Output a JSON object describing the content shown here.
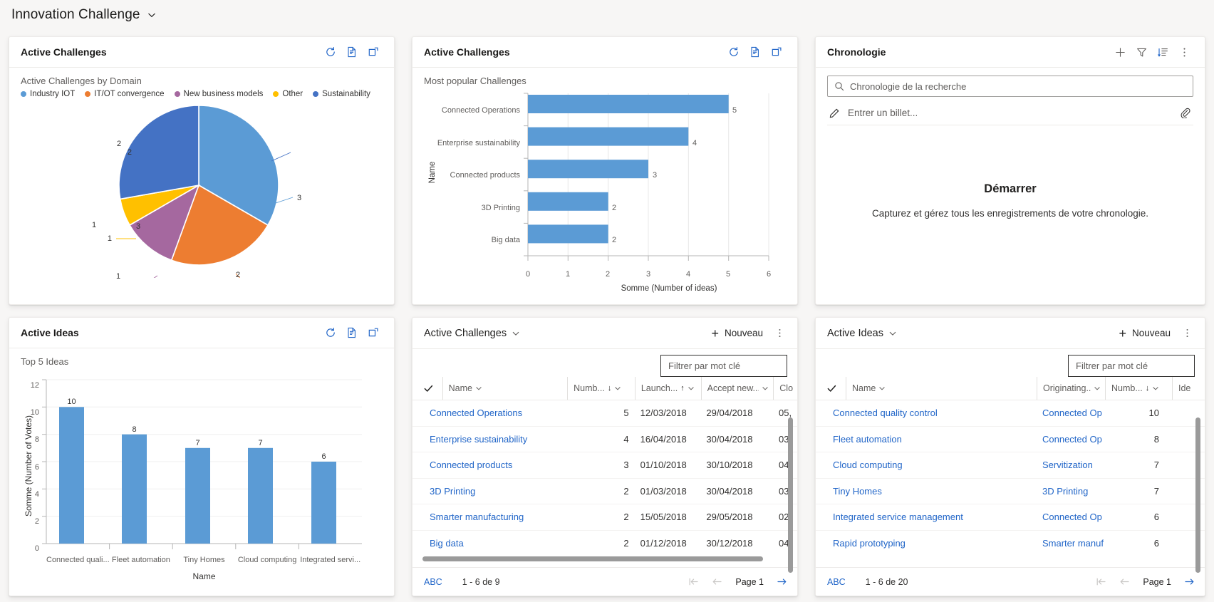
{
  "app": {
    "title": "Innovation Challenge",
    "chevron_icon": "chevron-down-icon"
  },
  "colors": {
    "accent_blue": "#5b9bd5",
    "link_blue": "#2266c8",
    "pie": [
      "#5b9bd5",
      "#ed7d31",
      "#a5689f",
      "#ffc000",
      "#4472c4"
    ],
    "bar_blue": "#5b9bd5",
    "border": "#edebe9"
  },
  "cards": {
    "active_challenges_pie": {
      "title": "Active Challenges",
      "subtitle": "Active Challenges by Domain",
      "icons": [
        "refresh-icon",
        "report-icon",
        "popout-icon"
      ]
    },
    "active_challenges_bar": {
      "title": "Active Challenges",
      "subtitle": "Most popular Challenges",
      "icons": [
        "refresh-icon",
        "report-icon",
        "popout-icon"
      ]
    },
    "timeline": {
      "title": "Chronologie",
      "icons": [
        "plus-icon",
        "filter-icon",
        "sort-icon",
        "more-vertical-icon"
      ],
      "search_placeholder": "Chronologie de la recherche",
      "search_icon": "search-icon",
      "note_placeholder": "Entrer un billet...",
      "note_icon": "pencil-icon",
      "attach_icon": "attachment-icon",
      "empty_title": "Démarrer",
      "empty_text": "Capturez et gérez tous les enregistrements de votre chronologie."
    },
    "active_ideas_chart": {
      "title": "Active Ideas",
      "subtitle": "Top 5 Ideas",
      "icons": [
        "refresh-icon",
        "report-icon",
        "popout-icon"
      ]
    },
    "active_challenges_grid": {
      "title": "Active Challenges",
      "title_chevron": "chevron-down-icon",
      "new_label": "Nouveau",
      "new_icon": "plus-icon",
      "more_icon": "more-vertical-icon",
      "filter_placeholder": "Filtrer par mot clé",
      "columns": [
        {
          "label": "Name",
          "sort": "",
          "chevron": "chevron-down-icon"
        },
        {
          "label": "Numb...",
          "sort": "↓",
          "chevron": "chevron-down-icon"
        },
        {
          "label": "Launch...",
          "sort": "↑",
          "chevron": "chevron-down-icon"
        },
        {
          "label": "Accept new...",
          "sort": "",
          "chevron": "chevron-down-icon"
        },
        {
          "label": "Clo",
          "sort": "",
          "chevron": ""
        }
      ],
      "rows": [
        {
          "name": "Connected Operations",
          "number": "5",
          "launch": "12/03/2018",
          "accept": "29/04/2018",
          "close": "05,"
        },
        {
          "name": "Enterprise sustainability",
          "number": "4",
          "launch": "16/04/2018",
          "accept": "30/04/2018",
          "close": "03,"
        },
        {
          "name": "Connected products",
          "number": "3",
          "launch": "01/10/2018",
          "accept": "30/10/2018",
          "close": "04,"
        },
        {
          "name": "3D Printing",
          "number": "2",
          "launch": "01/03/2018",
          "accept": "30/04/2018",
          "close": "03,"
        },
        {
          "name": "Smarter manufacturing",
          "number": "2",
          "launch": "15/05/2018",
          "accept": "29/05/2018",
          "close": "02,"
        },
        {
          "name": "Big data",
          "number": "2",
          "launch": "01/12/2018",
          "accept": "30/12/2018",
          "close": "04,"
        }
      ],
      "footer": {
        "abc": "ABC",
        "range": "1 - 6 de 9",
        "page_label": "Page 1",
        "first_icon": "page-first-icon",
        "prev_icon": "page-prev-icon",
        "next_icon": "page-next-icon"
      }
    },
    "active_ideas_grid": {
      "title": "Active Ideas",
      "title_chevron": "chevron-down-icon",
      "new_label": "Nouveau",
      "new_icon": "plus-icon",
      "more_icon": "more-vertical-icon",
      "filter_placeholder": "Filtrer par mot clé",
      "columns": [
        {
          "label": "Name",
          "sort": "",
          "chevron": "chevron-down-icon"
        },
        {
          "label": "Originating...",
          "sort": "",
          "chevron": "chevron-down-icon"
        },
        {
          "label": "Numb...",
          "sort": "↓",
          "chevron": "chevron-down-icon"
        },
        {
          "label": "Ide",
          "sort": "",
          "chevron": ""
        }
      ],
      "rows": [
        {
          "name": "Connected quality control",
          "originating": "Connected Op",
          "number": "10"
        },
        {
          "name": "Fleet automation",
          "originating": "Connected Op",
          "number": "8"
        },
        {
          "name": "Cloud computing",
          "originating": "Servitization",
          "number": "7"
        },
        {
          "name": "Tiny Homes",
          "originating": "3D Printing",
          "number": "7"
        },
        {
          "name": "Integrated service management",
          "originating": "Connected Op",
          "number": "6"
        },
        {
          "name": "Rapid prototyping",
          "originating": "Smarter manuf",
          "number": "6"
        }
      ],
      "footer": {
        "abc": "ABC",
        "range": "1 - 6 de 20",
        "page_label": "Page 1",
        "first_icon": "page-first-icon",
        "prev_icon": "page-prev-icon",
        "next_icon": "page-next-icon"
      }
    }
  },
  "chart_data": [
    {
      "id": "active-challenges-by-domain",
      "type": "pie",
      "title": "Active Challenges by Domain",
      "legend_position": "top",
      "labels": [
        "Industry IOT",
        "IT/OT convergence",
        "New business models",
        "Other",
        "Sustainability"
      ],
      "values": [
        3,
        2,
        1,
        1,
        2
      ],
      "colors": [
        "#5b9bd5",
        "#ed7d31",
        "#a5689f",
        "#ffc000",
        "#4472c4"
      ],
      "data_labels": [
        "3",
        "2",
        "1",
        "1",
        "2"
      ]
    },
    {
      "id": "most-popular-challenges",
      "type": "bar",
      "orientation": "horizontal",
      "title": "Most popular Challenges",
      "xlabel": "Somme (Number of ideas)",
      "ylabel": "Name",
      "categories": [
        "Connected Operations",
        "Enterprise sustainability",
        "Connected products",
        "3D Printing",
        "Big data"
      ],
      "values": [
        5,
        4,
        3,
        2,
        2
      ],
      "xlim": [
        0,
        6
      ],
      "xticks": [
        "0",
        "1",
        "2",
        "3",
        "4",
        "5",
        "6"
      ],
      "grid": true,
      "color": "#5b9bd5"
    },
    {
      "id": "top-5-ideas",
      "type": "bar",
      "orientation": "vertical",
      "title": "Top 5 Ideas",
      "xlabel": "Name",
      "ylabel": "Somme (Number of Votes)",
      "categories": [
        "Connected quali...",
        "Fleet automation",
        "Tiny Homes",
        "Cloud computing",
        "Integrated servi..."
      ],
      "values": [
        10,
        8,
        7,
        7,
        6
      ],
      "ylim": [
        0,
        12
      ],
      "yticks": [
        "0",
        "2",
        "4",
        "6",
        "8",
        "10",
        "12"
      ],
      "grid": true,
      "color": "#5b9bd5"
    }
  ]
}
